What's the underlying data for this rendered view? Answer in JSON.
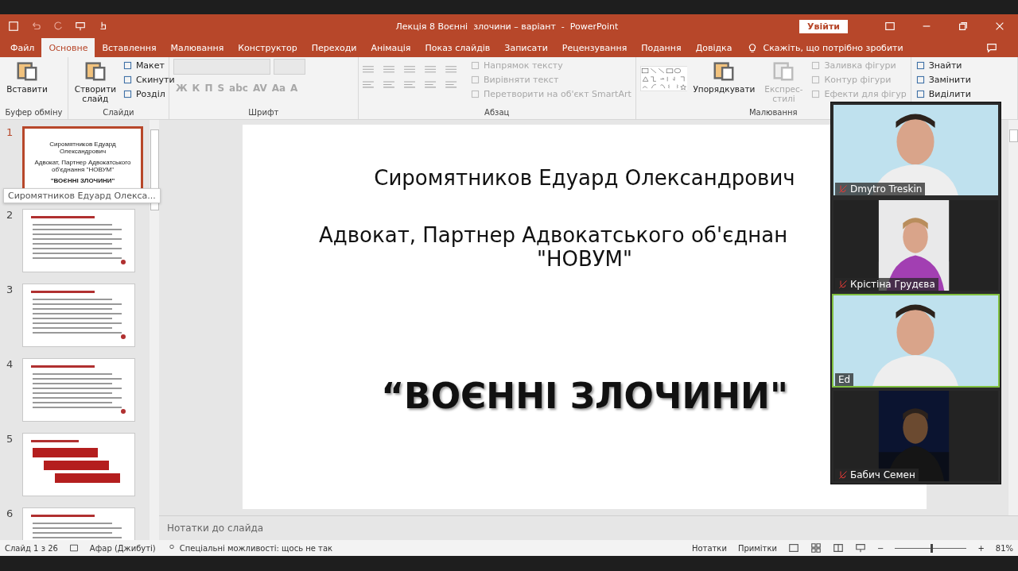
{
  "window": {
    "title": "Лекція 8 Воєнні  злочини – варіант  -  PowerPoint",
    "sign_in": "Увійти"
  },
  "tabs": [
    {
      "label": "Файл",
      "selected": false
    },
    {
      "label": "Основне",
      "selected": true
    },
    {
      "label": "Вставлення",
      "selected": false
    },
    {
      "label": "Малювання",
      "selected": false
    },
    {
      "label": "Конструктор",
      "selected": false
    },
    {
      "label": "Переходи",
      "selected": false
    },
    {
      "label": "Анімація",
      "selected": false
    },
    {
      "label": "Показ слайдів",
      "selected": false
    },
    {
      "label": "Записати",
      "selected": false
    },
    {
      "label": "Рецензування",
      "selected": false
    },
    {
      "label": "Подання",
      "selected": false
    },
    {
      "label": "Довідка",
      "selected": false
    }
  ],
  "tell_me": "Скажіть, що потрібно зробити",
  "ribbon": {
    "groups": [
      {
        "title": "Буфер обміну",
        "items": [
          {
            "kind": "large",
            "label": "Вставити",
            "disabled": false
          }
        ]
      },
      {
        "title": "Слайди",
        "items": [
          {
            "kind": "large",
            "label": "Створити слайд",
            "disabled": false
          },
          {
            "kind": "small",
            "label": "Макет",
            "disabled": false
          },
          {
            "kind": "small",
            "label": "Скинути",
            "disabled": false
          },
          {
            "kind": "small",
            "label": "Розділ",
            "disabled": false
          }
        ]
      },
      {
        "title": "Шрифт",
        "items": [
          {
            "kind": "glyph",
            "label": "Ж",
            "disabled": true
          },
          {
            "kind": "glyph",
            "label": "К",
            "disabled": true
          },
          {
            "kind": "glyph",
            "label": "П",
            "disabled": true
          },
          {
            "kind": "glyph",
            "label": "S",
            "disabled": true
          },
          {
            "kind": "glyph",
            "label": "abc",
            "disabled": true
          },
          {
            "kind": "glyph",
            "label": "AV",
            "disabled": true
          },
          {
            "kind": "glyph",
            "label": "Aa",
            "disabled": true
          },
          {
            "kind": "glyph",
            "label": "A",
            "disabled": true
          }
        ]
      },
      {
        "title": "Абзац",
        "items": [
          {
            "kind": "small",
            "label": "Напрямок тексту",
            "disabled": true
          },
          {
            "kind": "small",
            "label": "Вирівняти текст",
            "disabled": true
          },
          {
            "kind": "small",
            "label": "Перетворити на об'єкт SmartArt",
            "disabled": true
          }
        ]
      },
      {
        "title": "Малювання",
        "items": [
          {
            "kind": "large",
            "label": "Упорядкувати",
            "disabled": false
          },
          {
            "kind": "large",
            "label": "Експрес-стилі",
            "disabled": true
          },
          {
            "kind": "small",
            "label": "Заливка фігури",
            "disabled": true
          },
          {
            "kind": "small",
            "label": "Контур фігури",
            "disabled": true
          },
          {
            "kind": "small",
            "label": "Ефекти для фігур",
            "disabled": true
          }
        ]
      },
      {
        "items": [
          {
            "kind": "small",
            "label": "Знайти",
            "disabled": false
          },
          {
            "kind": "small",
            "label": "Замінити",
            "disabled": false
          },
          {
            "kind": "small",
            "label": "Виділити",
            "disabled": false
          }
        ]
      }
    ]
  },
  "thumbnails": [
    {
      "number": "1",
      "selected": true,
      "kind": "title",
      "lines": [
        "Сиромятников Едуард Олександрович",
        "Адвокат, Партнер Адвокатського об'єднання \"НОВУМ\"",
        "\"ВОЄННІ ЗЛОЧИНИ\""
      ]
    },
    {
      "number": "2",
      "selected": false,
      "kind": "text"
    },
    {
      "number": "3",
      "selected": false,
      "kind": "text"
    },
    {
      "number": "4",
      "selected": false,
      "kind": "text"
    },
    {
      "number": "5",
      "selected": false,
      "kind": "diagram"
    },
    {
      "number": "6",
      "selected": false,
      "kind": "text"
    }
  ],
  "tooltip": "Сиромятников Едуард Олекса...",
  "slide": {
    "name": "Сиромятников Едуард Олександрович",
    "role": "Адвокат, Партнер Адвокатського об'єднан",
    "org": "\"НОВУМ\"",
    "title": "“ВОЄННІ ЗЛОЧИНИ\""
  },
  "notes": {
    "placeholder": "Нотатки до слайда"
  },
  "status_bar": {
    "slide": "Слайд 1 з 26",
    "language": "Афар (Джибуті)",
    "accessibility": "Спеціальні можливості: щось не так",
    "notes": "Нотатки",
    "comments": "Примітки",
    "zoom_out": "−",
    "zoom_in": "+",
    "zoom": "81%",
    "level": 0.5
  },
  "participants": [
    {
      "name": "Dmytro Treskin",
      "muted": true,
      "active": false,
      "kind": "wide"
    },
    {
      "name": "Крістіна Грудєва",
      "muted": true,
      "active": false,
      "kind": "narrow"
    },
    {
      "name": "Ed",
      "muted": false,
      "active": true,
      "kind": "wide"
    },
    {
      "name": "Бабич Семен",
      "muted": true,
      "active": false,
      "kind": "dark"
    }
  ]
}
